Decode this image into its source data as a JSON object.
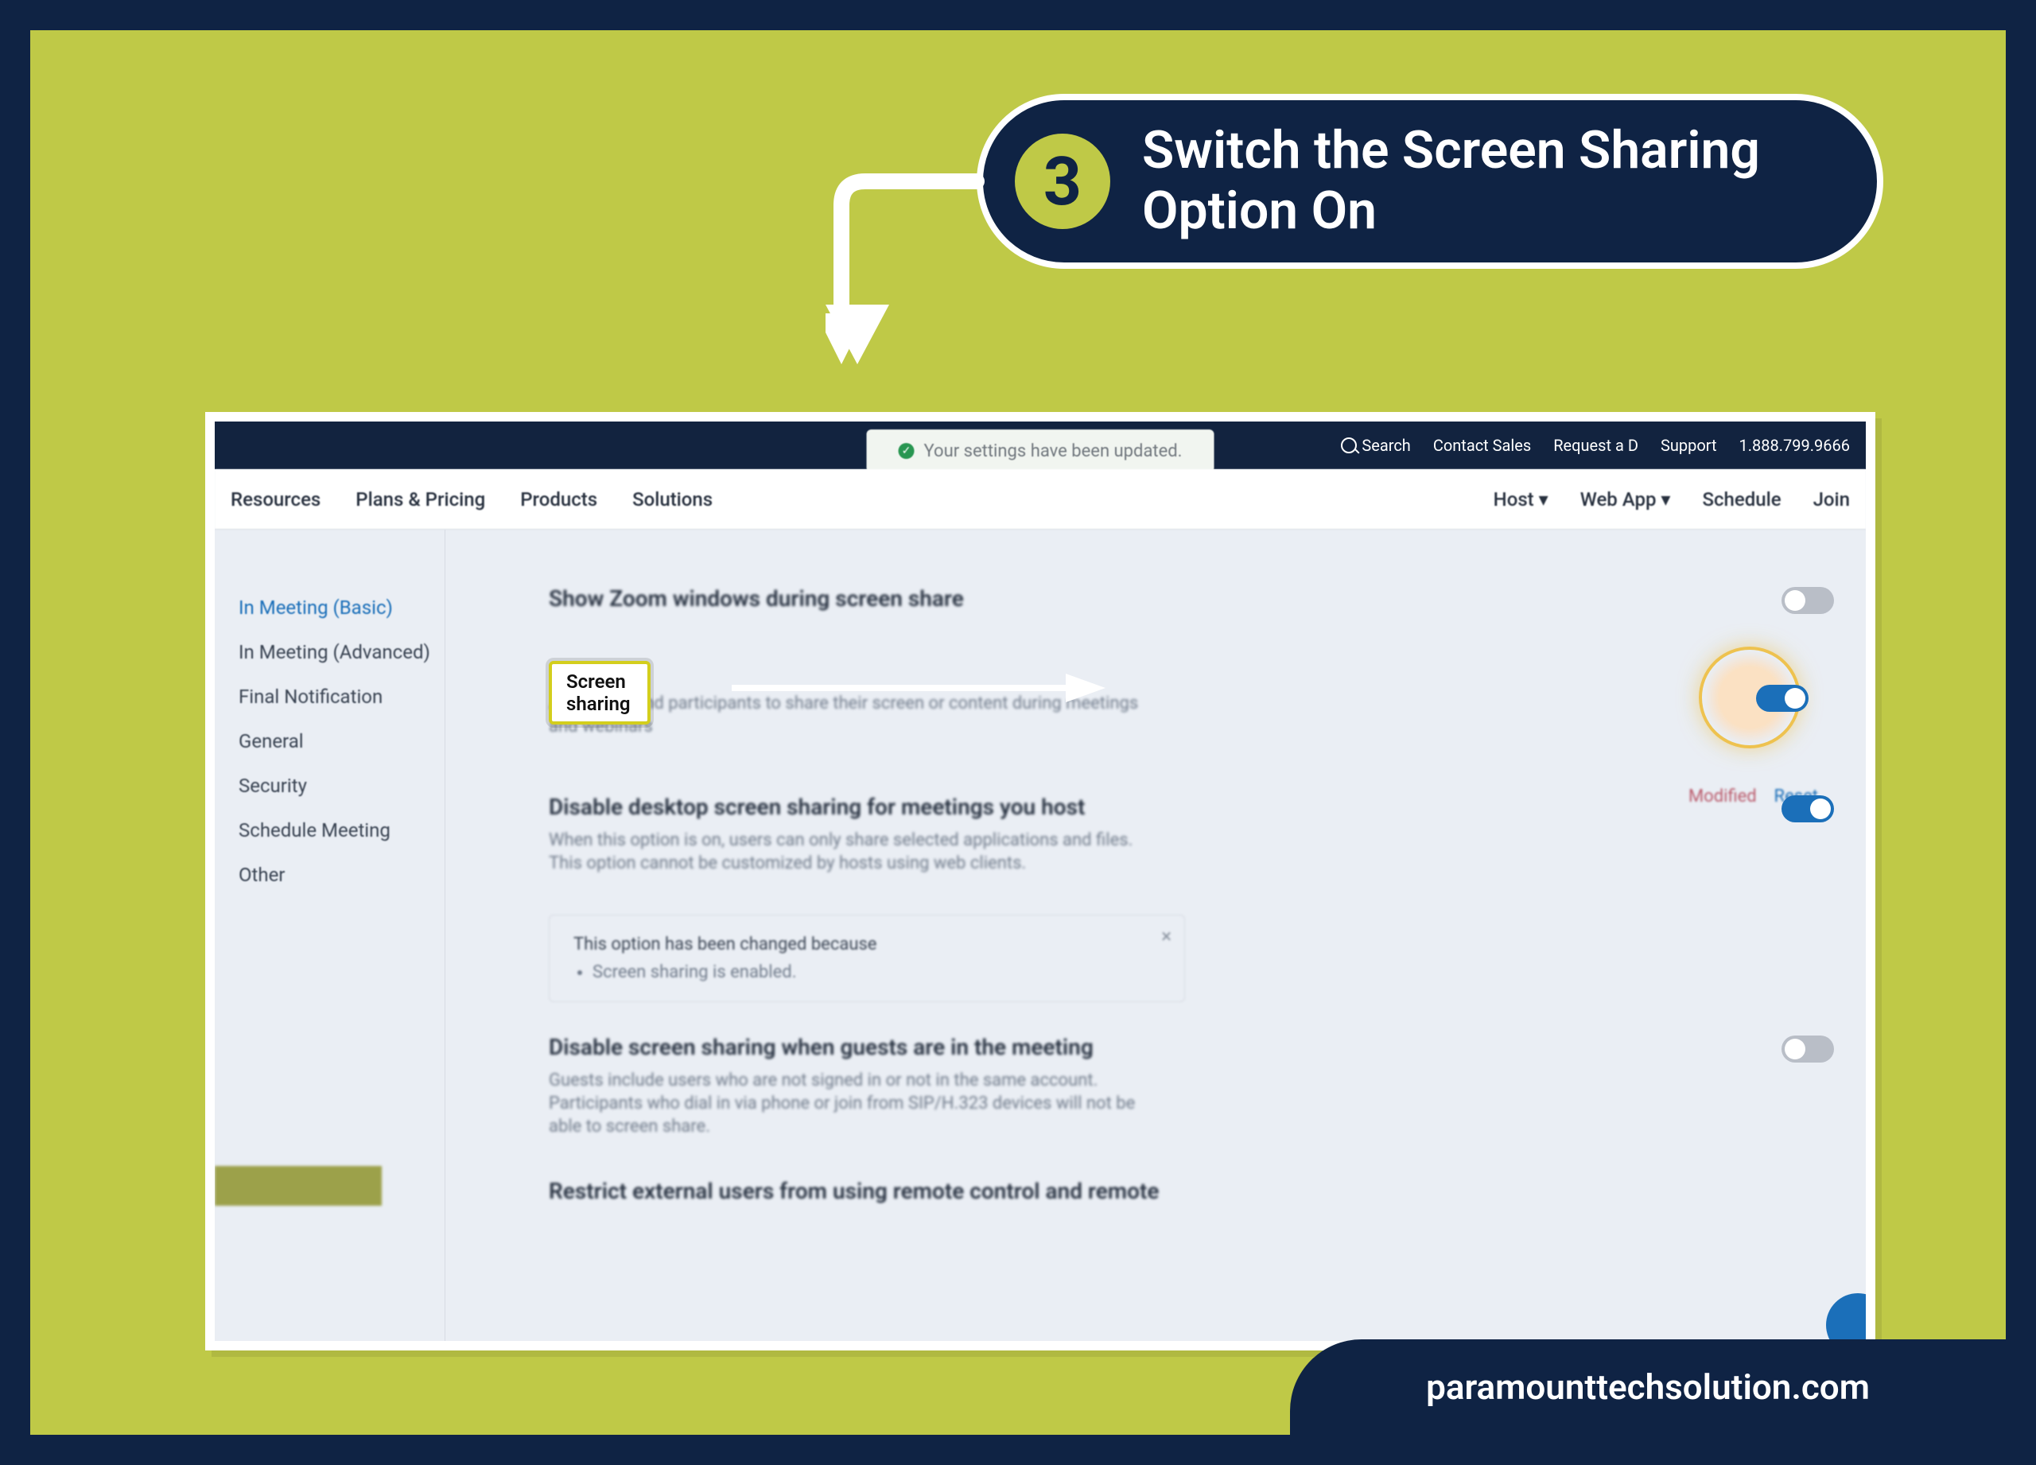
{
  "callout": {
    "step": "3",
    "text": "Switch the Screen Sharing Option On"
  },
  "footer": {
    "domain": "paramounttechsolution.com"
  },
  "screenshot": {
    "toast": "Your settings have been updated.",
    "topbar": {
      "search": "Search",
      "links": [
        "Contact Sales",
        "Request a D",
        "Support",
        "1.888.799.9666"
      ]
    },
    "secondbar": {
      "left": [
        "Resources",
        "Plans & Pricing",
        "Products",
        "Solutions"
      ],
      "right": [
        "Host",
        "Web App",
        "Schedule",
        "Join"
      ]
    },
    "sidebar": [
      "In Meeting (Basic)",
      "In Meeting (Advanced)",
      "Final Notification",
      "General",
      "Security",
      "Schedule Meeting",
      "Other"
    ],
    "status": {
      "modified": "Modified",
      "reset": "Reset"
    },
    "options": {
      "show_zoom_windows": {
        "title": "Show Zoom windows during screen share",
        "on": false
      },
      "screen_sharing": {
        "title": "Screen sharing",
        "desc": "Allow host and participants to share their screen or content during meetings and webinars",
        "on": true,
        "highlight_label": "Screen sharing"
      },
      "disable_desktop": {
        "title": "Disable desktop screen sharing for meetings you host",
        "desc": "When this option is on, users can only share selected applications and files. This option cannot be customized by hosts using web clients.",
        "on": true
      },
      "changed_box": {
        "title": "This option has been changed because",
        "bullet": "Screen sharing is enabled."
      },
      "disable_guests": {
        "title": "Disable screen sharing when guests are in the meeting",
        "desc": "Guests include users who are not signed in or not in the same account. Participants who dial in via phone or join from SIP/H.323 devices will not be able to screen share.",
        "on": false
      },
      "restrict_external": {
        "title": "Restrict external users from using remote control and remote"
      }
    }
  }
}
